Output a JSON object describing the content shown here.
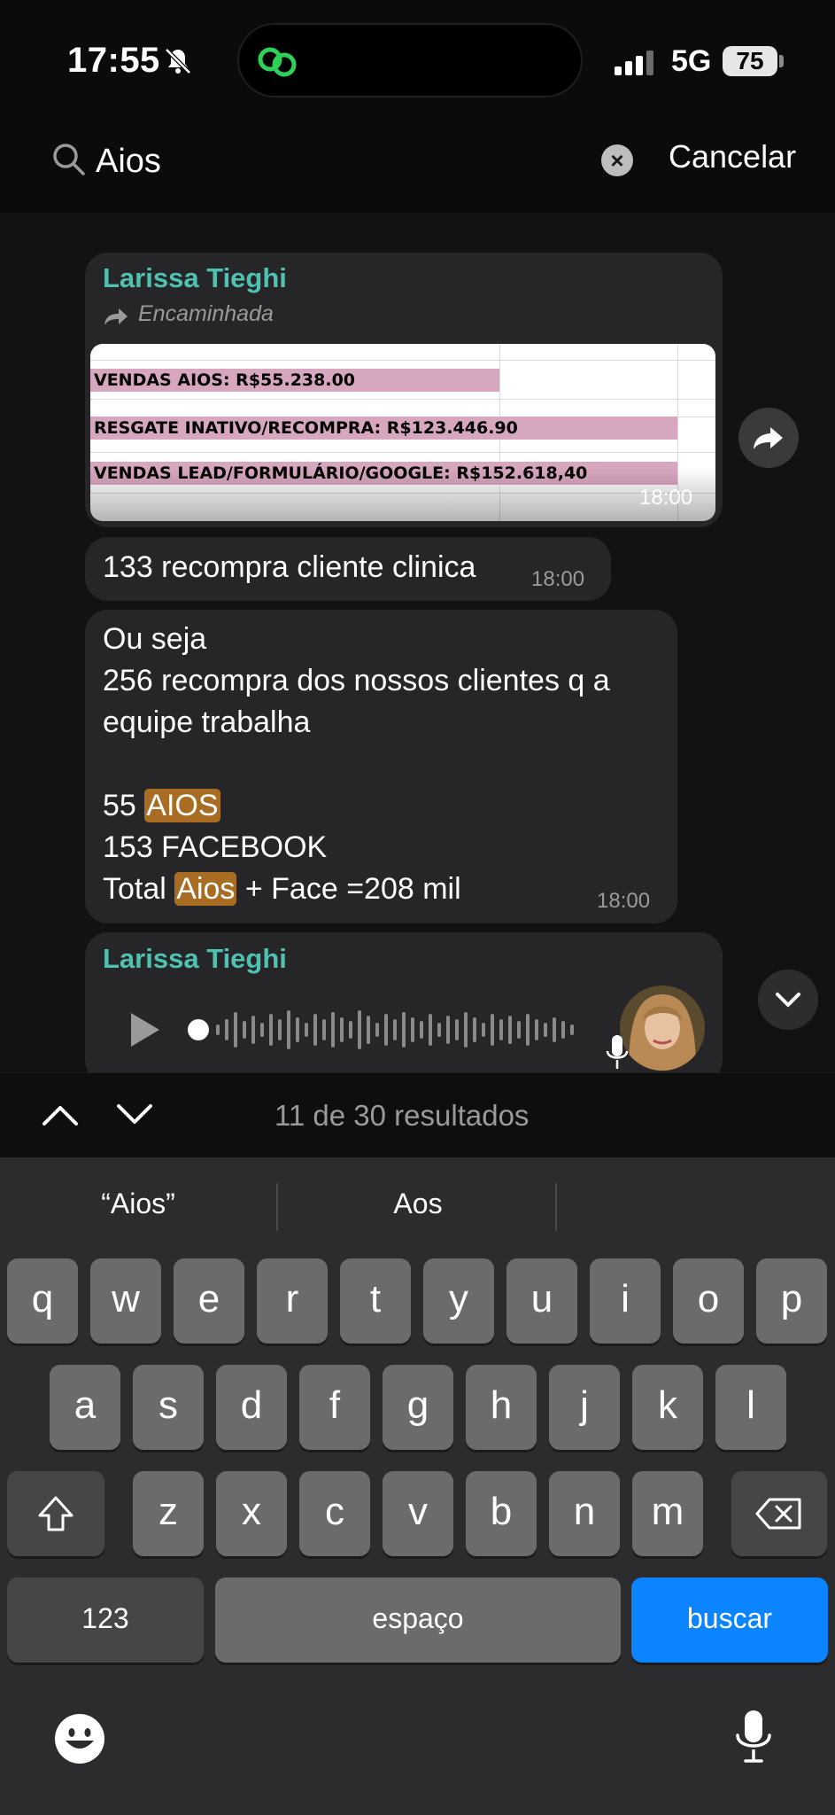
{
  "status_bar": {
    "time": "17:55",
    "network": "5G",
    "battery": "75"
  },
  "search": {
    "query": "Aios",
    "cancel_label": "Cancelar"
  },
  "messages": {
    "forwarded": {
      "sender": "Larissa Tieghi",
      "forwarded_label": "Encaminhada",
      "sheet_rows": [
        "VENDAS AIOS: R$55.238.00",
        "RESGATE INATIVO/RECOMPRA: R$123.446.90",
        "VENDAS LEAD/FORMULÁRIO/GOOGLE: R$152.618,40"
      ],
      "time": "18:00"
    },
    "msg1": {
      "text": "133 recompra cliente clinica",
      "time": "18:00"
    },
    "msg2": {
      "line1": "Ou seja",
      "line2": "256 recompra dos nossos clientes q a",
      "line3": "equipe trabalha",
      "line4_prefix": "55 ",
      "line4_highlight": "AIOS",
      "line5": "153 FACEBOOK",
      "line6_prefix": "Total ",
      "line6_highlight": "Aios",
      "line6_suffix": " + Face =208 mil",
      "time": "18:00"
    },
    "audio": {
      "sender": "Larissa Tieghi"
    }
  },
  "results": {
    "label": "11 de 30 resultados"
  },
  "keyboard": {
    "suggestions": [
      "“Aios”",
      "Aos"
    ],
    "row1": [
      "q",
      "w",
      "e",
      "r",
      "t",
      "y",
      "u",
      "i",
      "o",
      "p"
    ],
    "row2": [
      "a",
      "s",
      "d",
      "f",
      "g",
      "h",
      "j",
      "k",
      "l"
    ],
    "row3": [
      "z",
      "x",
      "c",
      "v",
      "b",
      "n",
      "m"
    ],
    "numbers_key": "123",
    "space_key": "espaço",
    "search_key": "buscar"
  },
  "colors": {
    "accent": "#0a84ff",
    "sender": "#4fc1b0",
    "highlight": "#a86d22"
  },
  "icons": [
    "bell-slash-icon",
    "search-icon",
    "clear-icon",
    "forward-icon",
    "share-icon",
    "play-icon",
    "mic-icon",
    "chevron-down-icon",
    "chevron-up-icon",
    "shift-icon",
    "backspace-icon",
    "emoji-icon"
  ]
}
